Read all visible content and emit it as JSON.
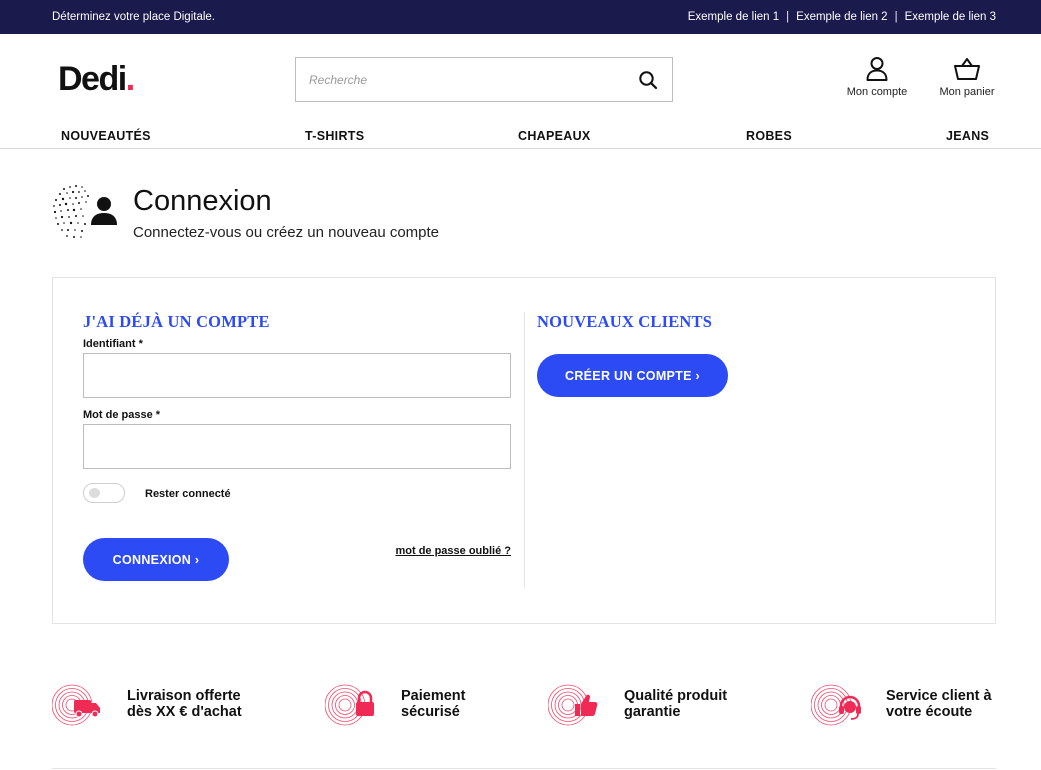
{
  "topbar": {
    "tagline": "Déterminez votre place Digitale.",
    "links": [
      "Exemple de lien 1",
      "Exemple de lien 2",
      "Exemple de lien 3"
    ],
    "separator": "|"
  },
  "header": {
    "logo_text": "Dedi",
    "logo_dot": ".",
    "search_placeholder": "Recherche",
    "account_label": "Mon compte",
    "basket_label": "Mon panier"
  },
  "nav": {
    "items": [
      "NOUVEAUTÉS",
      "T-SHIRTS",
      "CHAPEAUX",
      "ROBES",
      "JEANS"
    ]
  },
  "page": {
    "title": "Connexion",
    "subtitle": "Connectez-vous ou créez un nouveau compte"
  },
  "login": {
    "heading": "J'AI DÉJÀ UN COMPTE",
    "identifier_label": "Identifiant",
    "password_label": "Mot de passe",
    "required_mark": "*",
    "identifier_value": "",
    "password_value": "",
    "remember_label": "Rester connecté",
    "remember_on": false,
    "submit_label": "CONNEXION ›",
    "forgot_label": "mot de passe oublié ?"
  },
  "register": {
    "heading": "NOUVEAUX CLIENTS",
    "create_label": "CRÉER UN COMPTE ›"
  },
  "features": [
    {
      "icon": "truck-icon",
      "line1": "Livraison offerte",
      "line2": "dès XX € d'achat"
    },
    {
      "icon": "lock-icon",
      "line1": "Paiement",
      "line2": "sécurisé"
    },
    {
      "icon": "thumbs-up-icon",
      "line1": "Qualité produit",
      "line2": "garantie"
    },
    {
      "icon": "headset-icon",
      "line1": "Service client à",
      "line2": "votre écoute"
    }
  ],
  "colors": {
    "topbar_bg": "#1b1a4d",
    "accent_blue": "#2d4bf5",
    "accent_pink": "#ee2a55"
  }
}
